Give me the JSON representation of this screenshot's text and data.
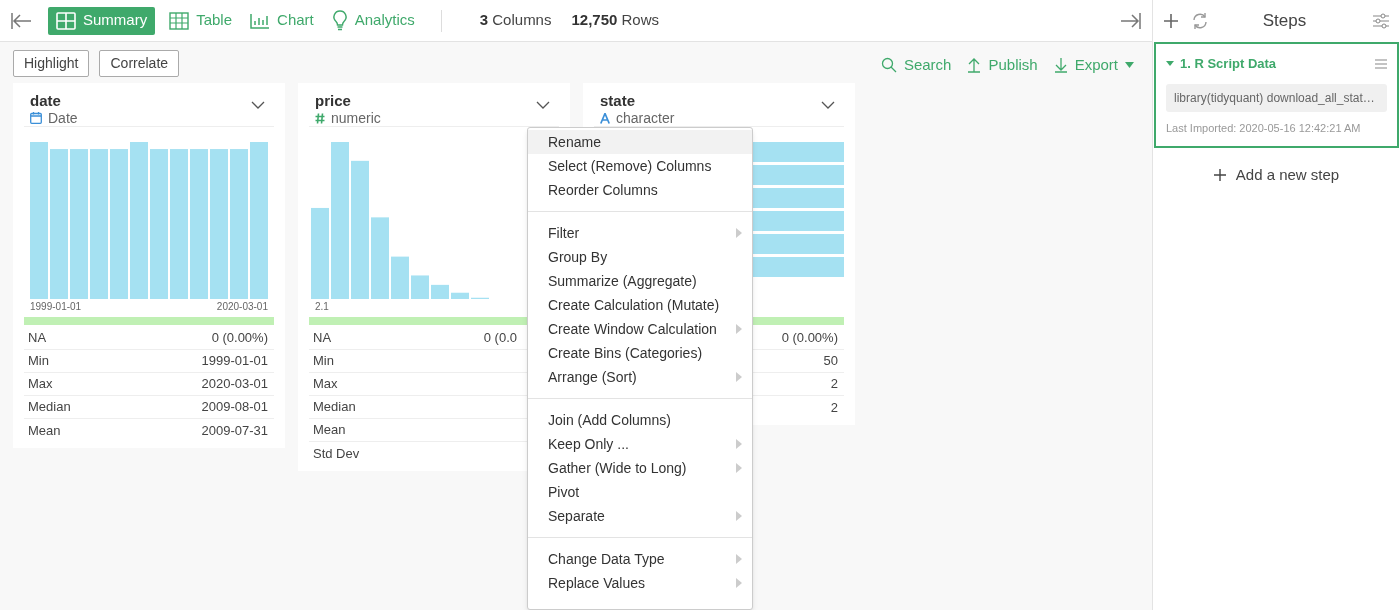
{
  "toolbar": {
    "tabs": [
      {
        "label": "Summary",
        "selected": true
      },
      {
        "label": "Table",
        "selected": false
      },
      {
        "label": "Chart",
        "selected": false
      },
      {
        "label": "Analytics",
        "selected": false
      }
    ],
    "stats": [
      "**3** Columns",
      "**12,750** Rows"
    ]
  },
  "actions": {
    "buttons": [
      "Highlight",
      "Correlate"
    ],
    "links": [
      "Search",
      "Publish",
      "Export"
    ]
  },
  "cards": [
    {
      "name": "date",
      "type": {
        "kind": "date",
        "label": "Date"
      },
      "axis": [
        "1999-01-01",
        "2020-03-01"
      ],
      "stats": [
        {
          "label": "NA",
          "value": "0 (0.00%)"
        },
        {
          "label": "Min",
          "value": "1999-01-01"
        },
        {
          "label": "Max",
          "value": "2020-03-01"
        },
        {
          "label": "Median",
          "value": "2009-08-01"
        },
        {
          "label": "Mean",
          "value": "2009-07-31"
        }
      ]
    },
    {
      "name": "price",
      "type": {
        "kind": "numeric",
        "label": "numeric"
      },
      "axis": [
        "2.1"
      ],
      "stats": [
        {
          "label": "NA",
          "value": "0 (0.0"
        },
        {
          "label": "Min"
        },
        {
          "label": "Max"
        },
        {
          "label": "Median"
        },
        {
          "label": "Mean"
        },
        {
          "label": "Std Dev"
        }
      ]
    },
    {
      "name": "state",
      "type": {
        "kind": "character",
        "label": "character"
      },
      "stats": [
        {
          "value": "0 (0.00%)"
        },
        {
          "value": "50"
        },
        {
          "value": "2"
        },
        {
          "value": "2"
        }
      ]
    }
  ],
  "context_menu": [
    [
      {
        "label": "Rename",
        "submenu": false,
        "highlighted": true
      },
      {
        "label": "Select (Remove) Columns",
        "submenu": false,
        "highlighted": false
      },
      {
        "label": "Reorder Columns",
        "submenu": false,
        "highlighted": false
      }
    ],
    [
      {
        "label": "Filter",
        "submenu": true,
        "highlighted": false
      },
      {
        "label": "Group By",
        "submenu": false,
        "highlighted": false
      },
      {
        "label": "Summarize (Aggregate)",
        "submenu": false,
        "highlighted": false
      },
      {
        "label": "Create Calculation (Mutate)",
        "submenu": false,
        "highlighted": false
      },
      {
        "label": "Create Window Calculation",
        "submenu": true,
        "highlighted": false
      },
      {
        "label": "Create Bins (Categories)",
        "submenu": false,
        "highlighted": false
      },
      {
        "label": "Arrange (Sort)",
        "submenu": true,
        "highlighted": false
      }
    ],
    [
      {
        "label": "Join (Add Columns)",
        "submenu": false,
        "highlighted": false
      },
      {
        "label": "Keep Only ...",
        "submenu": true,
        "highlighted": false
      },
      {
        "label": "Gather (Wide to Long)",
        "submenu": true,
        "highlighted": false
      },
      {
        "label": "Pivot",
        "submenu": false,
        "highlighted": false
      },
      {
        "label": "Separate",
        "submenu": true,
        "highlighted": false
      }
    ],
    [
      {
        "label": "Change Data Type",
        "submenu": true,
        "highlighted": false
      },
      {
        "label": "Replace Values",
        "submenu": true,
        "highlighted": false
      }
    ]
  ],
  "steps_panel": {
    "title": "Steps",
    "steps": [
      {
        "title": "1. R Script Data",
        "expanded": true,
        "selected": true,
        "code": "library(tidyquant) download_all_stat…",
        "note": "Last Imported: 2020-05-16 12:42:21 AM"
      }
    ],
    "add_step": "Add a new step"
  }
}
